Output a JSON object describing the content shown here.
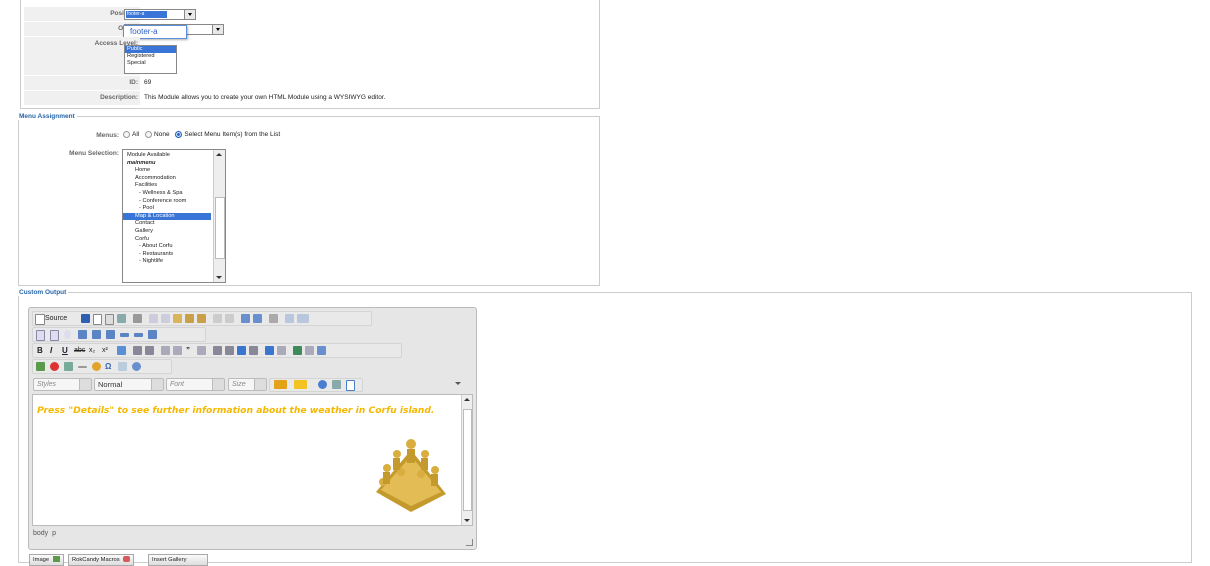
{
  "details": {
    "position": {
      "label": "Position:",
      "value": "footer-a",
      "popup": "footer-a"
    },
    "order": {
      "label": "Order:"
    },
    "access": {
      "label": "Access Level:",
      "options": [
        "Public",
        "Registered",
        "Special"
      ],
      "selected": "Public"
    },
    "id": {
      "label": "ID:",
      "value": "69"
    },
    "description": {
      "label": "Description:",
      "value": "This Module allows you to create your own HTML Module using a WYSIWYG editor."
    }
  },
  "menu_assignment": {
    "legend": "Menu Assignment",
    "menus_label": "Menus:",
    "radio_all": "All",
    "radio_none": "None",
    "radio_select": "Select Menu Item(s) from the List",
    "selection_label": "Menu Selection:",
    "items": [
      {
        "t": "Module Available",
        "k": "hdr0"
      },
      {
        "t": "mainmenu",
        "k": "hdr"
      },
      {
        "t": "Home",
        "k": "n"
      },
      {
        "t": "Accommodation",
        "k": "n"
      },
      {
        "t": "Facilities",
        "k": "n"
      },
      {
        "t": "- Wellness & Spa",
        "k": "n2"
      },
      {
        "t": "- Conference room",
        "k": "n2"
      },
      {
        "t": "- Pool",
        "k": "n2"
      },
      {
        "t": "Map & Location",
        "k": "sel"
      },
      {
        "t": "Contact",
        "k": "n"
      },
      {
        "t": "Gallery",
        "k": "n"
      },
      {
        "t": "Corfu",
        "k": "n"
      },
      {
        "t": "- About Corfu",
        "k": "n2"
      },
      {
        "t": "- Restaurants",
        "k": "n2"
      },
      {
        "t": "- Nightlife",
        "k": "n2"
      }
    ]
  },
  "custom_output": {
    "legend": "Custom Output",
    "source_label": "Source",
    "styles": "Styles",
    "format": "Normal",
    "font": "Font",
    "size": "Size",
    "content": "Press \"Details\" to see further information about the weather in Corfu island.",
    "status": "body  p",
    "buttons": {
      "image": "Image",
      "rokcandy": "RokCandy Macros",
      "gallery": "Insert Gallery"
    }
  },
  "colors": {
    "legend": "#2565a7",
    "content_text": "#f5b800",
    "highlight": "#3875d7"
  }
}
